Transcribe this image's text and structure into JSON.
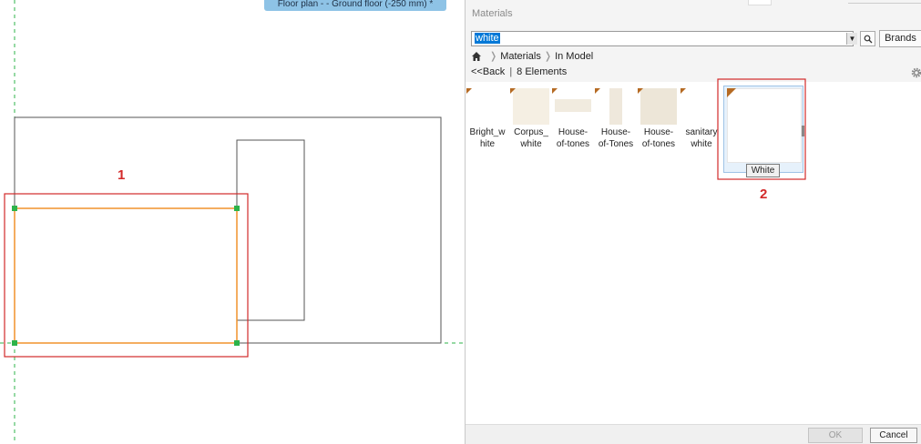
{
  "canvas": {
    "view_tab": "Floor plan -  - Ground floor (-250 mm) *",
    "callout_1": "1",
    "callout_2": "2",
    "colors": {
      "guide": "#2db34a",
      "selection": "#f0922b",
      "walls": "#555555",
      "highlight": "#d32a2a"
    }
  },
  "panel": {
    "title": "Materials",
    "search": {
      "value": "white",
      "search_icon": "search-icon",
      "brands_label": "Brands"
    },
    "breadcrumb": {
      "home_icon": "home-icon",
      "items": [
        "Materials",
        "In Model"
      ]
    },
    "nav": {
      "back_label": "<<Back",
      "count_label": "8 Elements"
    },
    "settings_icon": "gear-icon",
    "materials": [
      {
        "line1": "Bright_w",
        "line2": "hite",
        "swatch": "#ffffff"
      },
      {
        "line1": "Corpus_",
        "line2": "white",
        "swatch": "#f5efe3"
      },
      {
        "line1": "House-",
        "line2": "of-tones",
        "swatch": "#f1ebdf"
      },
      {
        "line1": "House-",
        "line2": "of-Tones",
        "swatch": "#efe8dc"
      },
      {
        "line1": "House-",
        "line2": "of-tones",
        "swatch": "#ede6d8"
      },
      {
        "line1": "sanitary",
        "line2": "white",
        "swatch": "#ffffff"
      }
    ],
    "selected_material": {
      "tooltip": "White",
      "swatch": "#ffffff"
    },
    "footer": {
      "ok_label": "OK",
      "cancel_label": "Cancel"
    }
  }
}
